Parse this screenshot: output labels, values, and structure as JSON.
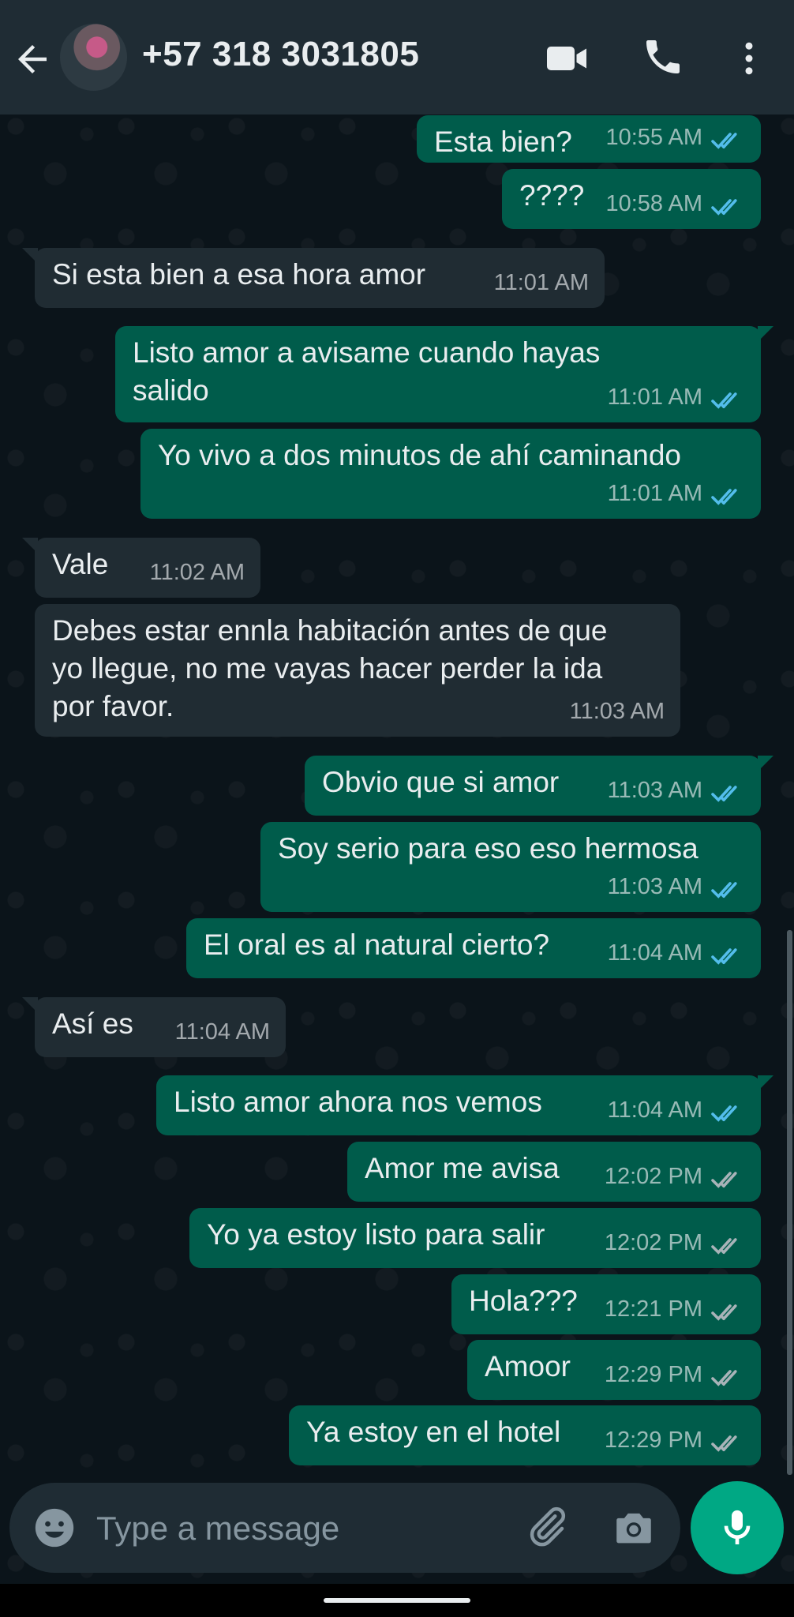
{
  "header": {
    "contact_name": "+57 318 3031805",
    "back_icon": "arrow-left-icon",
    "video_icon": "video-camera-icon",
    "call_icon": "phone-icon",
    "menu_icon": "more-vertical-icon"
  },
  "messages": [
    {
      "dir": "out",
      "text": "Esta bien?",
      "time": "10:55 AM",
      "status": "read"
    },
    {
      "dir": "out",
      "text": "????",
      "time": "10:58 AM",
      "status": "read"
    },
    {
      "dir": "in",
      "text": "Si esta bien a esa hora amor",
      "time": "11:01 AM"
    },
    {
      "dir": "out",
      "text": "Listo amor a avisame cuando hayas\nsalido",
      "time": "11:01 AM",
      "status": "read"
    },
    {
      "dir": "out",
      "text": "Yo vivo a dos minutos de ahí caminando",
      "time": "11:01 AM",
      "status": "read"
    },
    {
      "dir": "in",
      "text": "Vale",
      "time": "11:02 AM"
    },
    {
      "dir": "in",
      "text": "Debes estar ennla habitación antes de que\nyo llegue, no me vayas hacer perder la ida\npor favor.",
      "time": "11:03 AM"
    },
    {
      "dir": "out",
      "text": "Obvio que si amor",
      "time": "11:03 AM",
      "status": "read"
    },
    {
      "dir": "out",
      "text": "Soy serio para eso eso hermosa",
      "time": "11:03 AM",
      "status": "read"
    },
    {
      "dir": "out",
      "text": "El oral es al natural cierto?",
      "time": "11:04 AM",
      "status": "read"
    },
    {
      "dir": "in",
      "text": "Así es",
      "time": "11:04 AM"
    },
    {
      "dir": "out",
      "text": "Listo amor ahora nos vemos",
      "time": "11:04 AM",
      "status": "read"
    },
    {
      "dir": "out",
      "text": "Amor me avisa",
      "time": "12:02 PM",
      "status": "delivered"
    },
    {
      "dir": "out",
      "text": "Yo ya estoy listo para salir",
      "time": "12:02 PM",
      "status": "delivered"
    },
    {
      "dir": "out",
      "text": "Hola???",
      "time": "12:21 PM",
      "status": "delivered"
    },
    {
      "dir": "out",
      "text": "Amoor",
      "time": "12:29 PM",
      "status": "delivered"
    },
    {
      "dir": "out",
      "text": "Ya estoy en el hotel",
      "time": "12:29 PM",
      "status": "delivered"
    }
  ],
  "composer": {
    "placeholder": "Type a message",
    "emoji_icon": "emoji-icon",
    "attach_icon": "paperclip-icon",
    "camera_icon": "camera-icon",
    "mic_icon": "microphone-icon"
  },
  "colors": {
    "header_bg": "#1f2c34",
    "chat_bg": "#0b141a",
    "outgoing_bubble": "#005c4b",
    "incoming_bubble": "#202c33",
    "read_tick": "#53bdeb",
    "delivered_tick": "#a8b3b8",
    "mic_button": "#00a884"
  }
}
